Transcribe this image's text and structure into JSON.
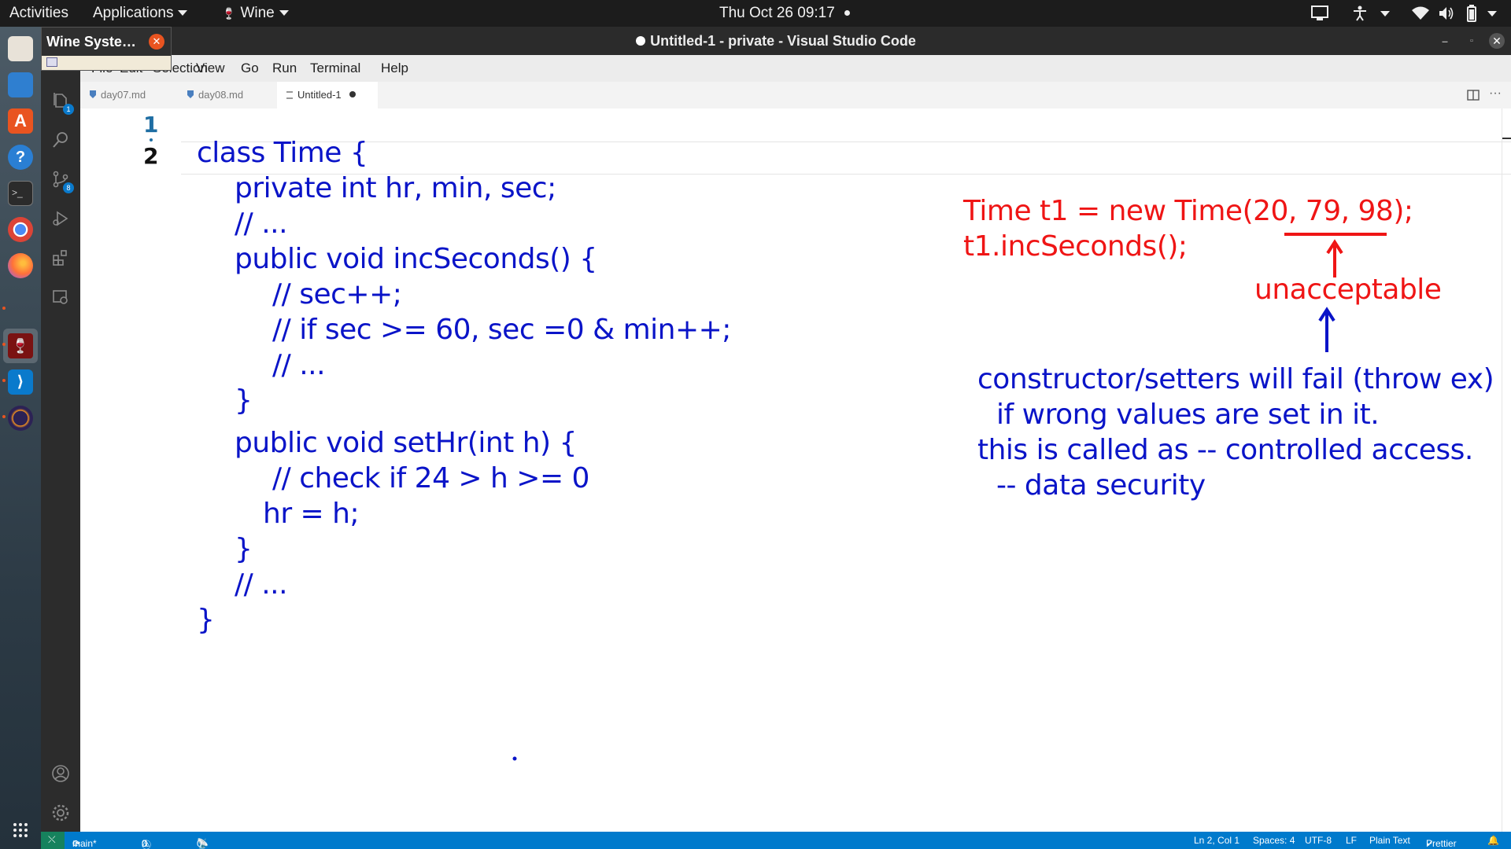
{
  "topbar": {
    "activities": "Activities",
    "applications": "Applications",
    "wine": "Wine",
    "clock": "Thu Oct 26  09:17"
  },
  "wine_popup": {
    "title": "Wine Syste…"
  },
  "window": {
    "title": "Untitled-1 - private - Visual Studio Code"
  },
  "menu": [
    "File",
    "Edit",
    "Selection",
    "View",
    "Go",
    "Run",
    "Terminal",
    "Help"
  ],
  "tabs": [
    {
      "label": "day07.md"
    },
    {
      "label": "day08.md"
    },
    {
      "label": "Untitled-1",
      "dirty": true
    }
  ],
  "activity_badges": {
    "explorer": "1",
    "scm": "8"
  },
  "editor": {
    "line_numbers": [
      "1",
      "2"
    ],
    "code_lines": [
      "class Time {",
      "private int hr, min, sec;",
      "// ...",
      "public void incSeconds() {",
      "// sec++;",
      "// if sec >= 60, sec =0 & min++;",
      "// ...",
      "}",
      "public void setHr(int h) {",
      "// check if 24 > h >= 0",
      "hr = h;",
      "}",
      "// ...",
      "}"
    ],
    "annotation_red": [
      "Time t1 = new Time(20, 79, 98);",
      "t1.incSeconds();",
      "unacceptable"
    ],
    "annotation_blue": [
      "constructor/setters will fail (throw ex)",
      "if wrong values are set in it.",
      "this is called as -- controlled access.",
      "-- data security"
    ],
    "colors": {
      "code": "#0a14c8",
      "red": "#ef1515",
      "blue": "#0a14c8"
    }
  },
  "statusbar": {
    "branch": "main*",
    "errors": "0",
    "warnings": "0",
    "ports": "0",
    "position": "Ln 2, Col 1",
    "spaces": "Spaces: 4",
    "encoding": "UTF-8",
    "eol": "LF",
    "language": "Plain Text",
    "formatter": "Prettier"
  }
}
